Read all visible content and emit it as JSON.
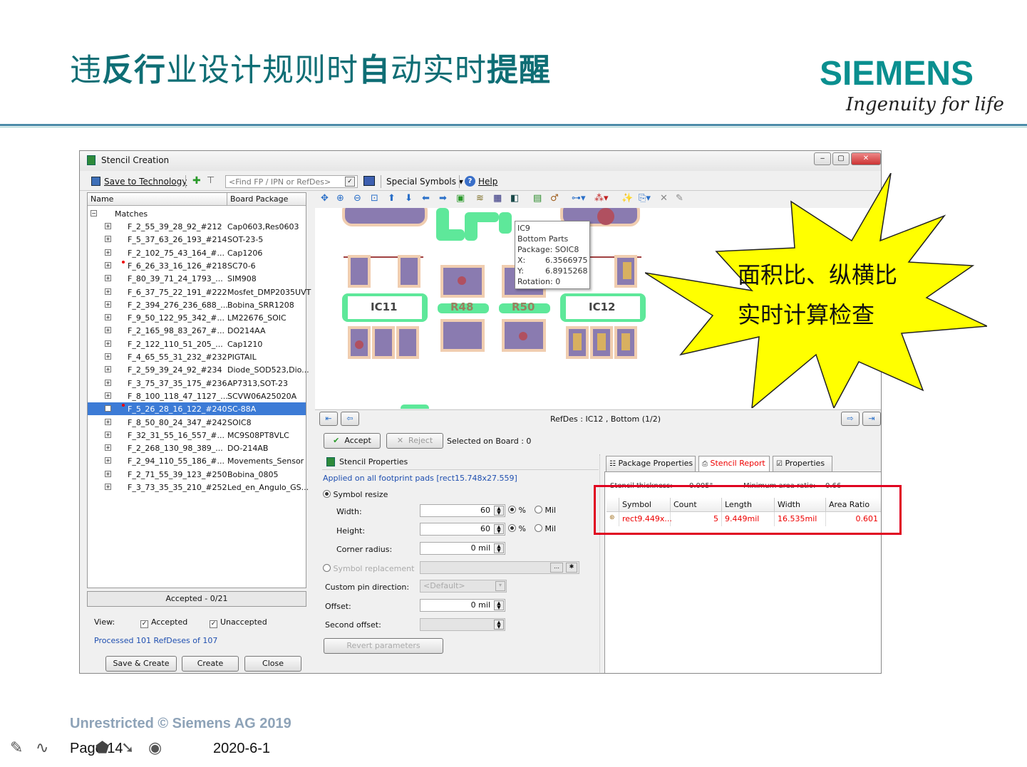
{
  "slide": {
    "title_parts": [
      "违",
      "反行",
      "业设计规则时",
      "自",
      "动实时",
      "提醒"
    ],
    "logo": "SIEMENS",
    "tagline": "Ingenuity for life",
    "colors": {
      "title": "#0f6e75",
      "logo": "#0a8f8f",
      "rule": "#4a8aa8",
      "callout": "#ffff00",
      "highlight": "#e00020"
    }
  },
  "window": {
    "title": "Stencil Creation",
    "controls": [
      "minimize",
      "maximize",
      "close"
    ]
  },
  "toolbar": {
    "save_to_technology": "Save to Technology",
    "find_placeholder": "<Find FP / IPN or RefDes>",
    "special_symbols": "Special Symbols",
    "help": "Help"
  },
  "tree": {
    "col_name": "Name",
    "col_package": "Board Package",
    "root": "Matches",
    "rows": [
      {
        "name": "F_2_55_39_28_92_#212",
        "pkg": "Cap0603,Res0603",
        "flag": false,
        "selected": false
      },
      {
        "name": "F_5_37_63_26_193_#214",
        "pkg": "SOT-23-5",
        "flag": false,
        "selected": false
      },
      {
        "name": "F_2_102_75_43_164_#...",
        "pkg": "Cap1206",
        "flag": false,
        "selected": false
      },
      {
        "name": "F_6_26_33_16_126_#218",
        "pkg": "SC70-6",
        "flag": true,
        "selected": false
      },
      {
        "name": "F_80_39_71_24_1793_...",
        "pkg": "SIM908",
        "flag": false,
        "selected": false
      },
      {
        "name": "F_6_37_75_22_191_#222",
        "pkg": "Mosfet_DMP2035UVT",
        "flag": false,
        "selected": false
      },
      {
        "name": "F_2_394_276_236_688_...",
        "pkg": "Bobina_SRR1208",
        "flag": false,
        "selected": false
      },
      {
        "name": "F_9_50_122_95_342_#...",
        "pkg": "LM22676_SOIC",
        "flag": false,
        "selected": false
      },
      {
        "name": "F_2_165_98_83_267_#...",
        "pkg": "DO214AA",
        "flag": false,
        "selected": false
      },
      {
        "name": "F_2_122_110_51_205_...",
        "pkg": "Cap1210",
        "flag": false,
        "selected": false
      },
      {
        "name": "F_4_65_55_31_232_#232",
        "pkg": "PIGTAIL",
        "flag": false,
        "selected": false
      },
      {
        "name": "F_2_59_39_24_92_#234",
        "pkg": "Diode_SOD523,Dio...",
        "flag": false,
        "selected": false
      },
      {
        "name": "F_3_75_37_35_175_#236",
        "pkg": "AP7313,SOT-23",
        "flag": false,
        "selected": false
      },
      {
        "name": "F_8_100_118_47_1127_...",
        "pkg": "SCVW06A25020A",
        "flag": false,
        "selected": false
      },
      {
        "name": "F_5_26_28_16_122_#240",
        "pkg": "SC-88A",
        "flag": true,
        "selected": true
      },
      {
        "name": "F_8_50_80_24_347_#242",
        "pkg": "SOIC8",
        "flag": false,
        "selected": false
      },
      {
        "name": "F_32_31_55_16_557_#...",
        "pkg": "MC9S08PT8VLC",
        "flag": false,
        "selected": false
      },
      {
        "name": "F_2_268_130_98_389_...",
        "pkg": "DO-214AB",
        "flag": false,
        "selected": false
      },
      {
        "name": "F_2_94_110_55_186_#...",
        "pkg": "Movements_Sensor",
        "flag": false,
        "selected": false
      },
      {
        "name": "F_2_71_55_39_123_#250",
        "pkg": "Bobina_0805",
        "flag": false,
        "selected": false
      },
      {
        "name": "F_3_73_35_35_210_#252",
        "pkg": "Led_en_Angulo_GS...",
        "flag": false,
        "selected": false
      }
    ],
    "accepted_status": "Accepted - 0/21"
  },
  "view_filter": {
    "label": "View:",
    "accepted": "Accepted",
    "unaccepted": "Unaccepted",
    "processed": "Processed 101 RefDeses of 107"
  },
  "bottom_buttons": {
    "save_create": "Save & Create",
    "create": "Create",
    "close": "Close"
  },
  "canvas": {
    "refdes_labels": [
      "IC11",
      "R48",
      "R50",
      "IC12"
    ],
    "tooltip": [
      "IC9",
      "Bottom Parts",
      "Package:  SOIC8",
      "X:",
      "6.3566975",
      "Y:",
      "6.8915268",
      "Rotation: 0"
    ]
  },
  "nav": {
    "refdes_status": "RefDes : IC12 , Bottom (1/2)"
  },
  "actions": {
    "accept": "Accept",
    "reject": "Reject",
    "selected_on_board": "Selected on Board : 0"
  },
  "stencil_props": {
    "header": "Stencil Properties",
    "applied": "Applied on all footprint pads [rect15.748x27.559]",
    "symbol_resize": "Symbol resize",
    "width_label": "Width:",
    "width_value": "60",
    "height_label": "Height:",
    "height_value": "60",
    "percent": "%",
    "mil": "Mil",
    "corner_label": "Corner radius:",
    "corner_value": "0 mil",
    "symbol_replacement": "Symbol replacement",
    "custom_pin_label": "Custom pin direction:",
    "custom_pin_value": "<Default>",
    "offset_label": "Offset:",
    "offset_value": "0 mil",
    "second_offset_label": "Second offset:",
    "revert": "Revert parameters"
  },
  "report": {
    "tabs": [
      "Package Properties",
      "Stencil Report",
      "Properties"
    ],
    "active_tab": 1,
    "stencil_thickness_label": "Stencil thickness:",
    "stencil_thickness_value": "0.005\"",
    "min_area_label": "Minimum area ratio:",
    "min_area_value": "0.66",
    "columns": [
      "Symbol",
      "Count",
      "Length",
      "Width",
      "Area Ratio"
    ],
    "rows": [
      [
        "rect9.449x...",
        "5",
        "9.449mil",
        "16.535mil",
        "0.601"
      ]
    ]
  },
  "callout": {
    "line1": "面积比、纵横比",
    "line2": "实时计算检查"
  },
  "footer": {
    "copyright": "Unrestricted © Siemens AG 2019",
    "page": "Page 14",
    "date": "2020-6-1"
  }
}
